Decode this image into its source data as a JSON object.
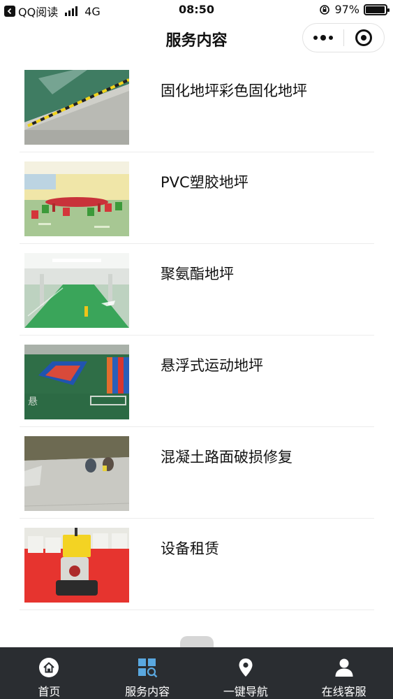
{
  "status_bar": {
    "carrier": "QQ阅读",
    "network": "4G",
    "time": "08:50",
    "battery": "97%",
    "battery_level": 0.97
  },
  "nav": {
    "title": "服务内容"
  },
  "services": [
    {
      "title": "固化地坪彩色固化地坪"
    },
    {
      "title": "PVC塑胶地坪"
    },
    {
      "title": "聚氨酯地坪"
    },
    {
      "title": "悬浮式运动地坪"
    },
    {
      "title": "混凝土路面破损修复"
    },
    {
      "title": "设备租赁"
    }
  ],
  "tabs": [
    {
      "label": "首页",
      "icon": "home-icon"
    },
    {
      "label": "服务内容",
      "icon": "grid-search-icon",
      "active": true
    },
    {
      "label": "一键导航",
      "icon": "location-pin-icon"
    },
    {
      "label": "在线客服",
      "icon": "user-icon"
    }
  ],
  "colors": {
    "tab_bar_bg": "#2a2d31",
    "active_tab_icon": "#5aa8e0",
    "tab_label": "#ffffff"
  }
}
